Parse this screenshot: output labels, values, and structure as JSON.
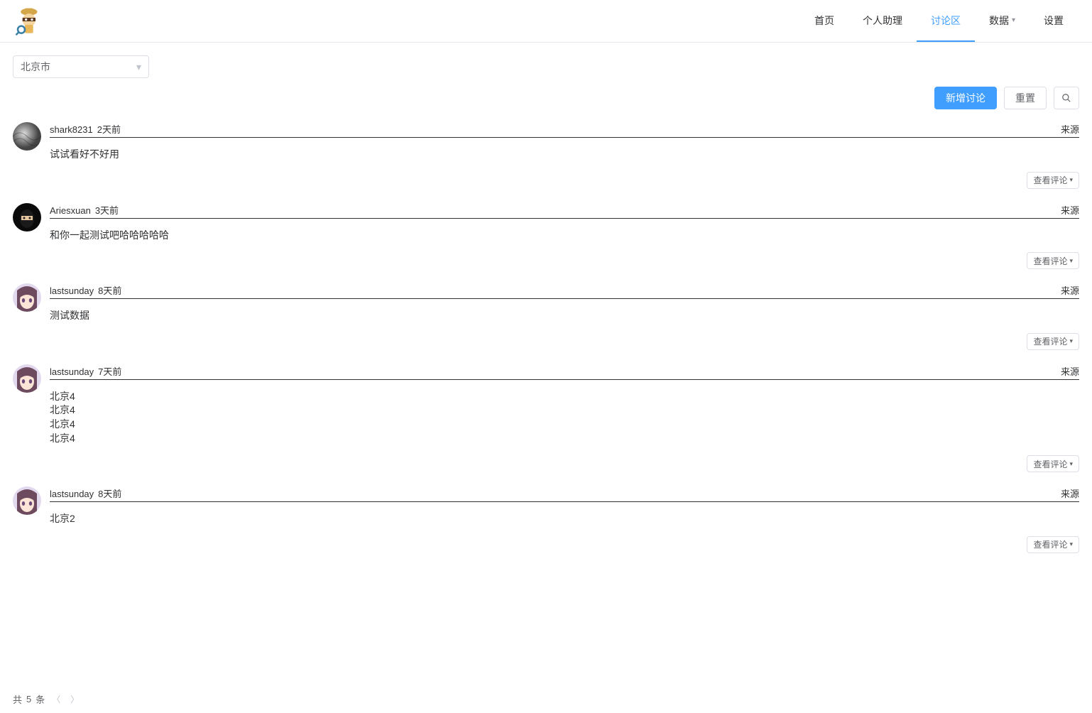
{
  "nav": {
    "items": [
      {
        "label": "首页"
      },
      {
        "label": "个人助理"
      },
      {
        "label": "讨论区"
      },
      {
        "label": "数据",
        "has_dropdown": true
      },
      {
        "label": "设置"
      }
    ],
    "active_index": 2
  },
  "filter": {
    "city_value": "北京市"
  },
  "toolbar": {
    "new_label": "新增讨论",
    "reset_label": "重置",
    "search_icon": "search-icon"
  },
  "labels": {
    "source": "来源",
    "view_comments": "查看评论"
  },
  "posts": [
    {
      "user": "shark8231",
      "time": "2天前",
      "content": "试试看好不好用",
      "avatar": "gray"
    },
    {
      "user": "Ariesxuan",
      "time": "3天前",
      "content": "和你一起测试吧哈哈哈哈哈",
      "avatar": "mask"
    },
    {
      "user": "lastsunday",
      "time": "8天前",
      "content": "测试数据",
      "avatar": "anime"
    },
    {
      "user": "lastsunday",
      "time": "7天前",
      "content": "北京4\n北京4\n北京4\n北京4",
      "avatar": "anime"
    },
    {
      "user": "lastsunday",
      "time": "8天前",
      "content": "北京2",
      "avatar": "anime"
    }
  ],
  "pagination": {
    "total_prefix": "共",
    "total_count": "5",
    "total_suffix": "条"
  }
}
